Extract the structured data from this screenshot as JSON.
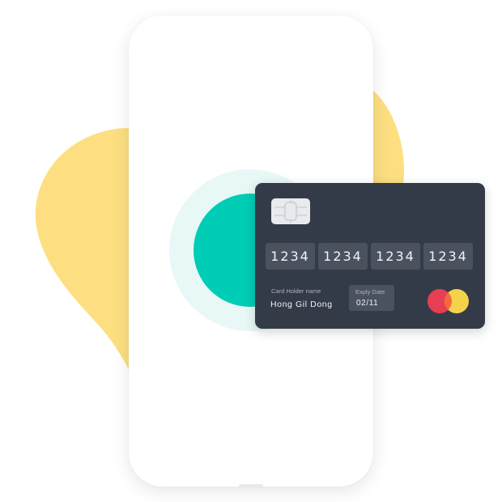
{
  "colors": {
    "blob": "#fddf82",
    "phone": "#ffffff",
    "ring_outer": "#e8f8f6",
    "ring_inner": "#00cdb6",
    "card": "#343b48",
    "card_box": "#4a5260",
    "mastercard_red": "#e63e52",
    "mastercard_yellow": "#f4d24c"
  },
  "card": {
    "number_groups": [
      "1234",
      "1234",
      "1234",
      "1234"
    ],
    "holder_label": "Card Holder name",
    "holder_name": "Hong Gil Dong",
    "expiry_label": "Exply Date",
    "expiry_value": "02/11",
    "chip_icon": "card-chip-icon",
    "brand_icon": "mastercard-logo-icon"
  }
}
